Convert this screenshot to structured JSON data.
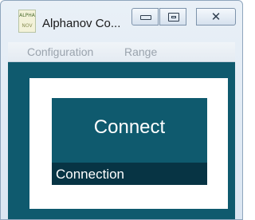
{
  "window": {
    "title": "Alphanov Co...",
    "icon_text_line1": "ALPHA",
    "icon_text_line2": "NOV",
    "controls": {
      "minimize_icon": "minimize-icon",
      "maximize_icon": "maximize-icon",
      "close_icon": "close-icon",
      "close_glyph": "✕"
    }
  },
  "menu": {
    "items": [
      {
        "label": "Configuration"
      },
      {
        "label": "Range"
      }
    ]
  },
  "main": {
    "connect_button_label": "Connect",
    "status_label": "Connection"
  },
  "colors": {
    "client_background": "#0f5a6e",
    "status_strip": "#073444",
    "menu_text_disabled": "#9aa3ad"
  }
}
